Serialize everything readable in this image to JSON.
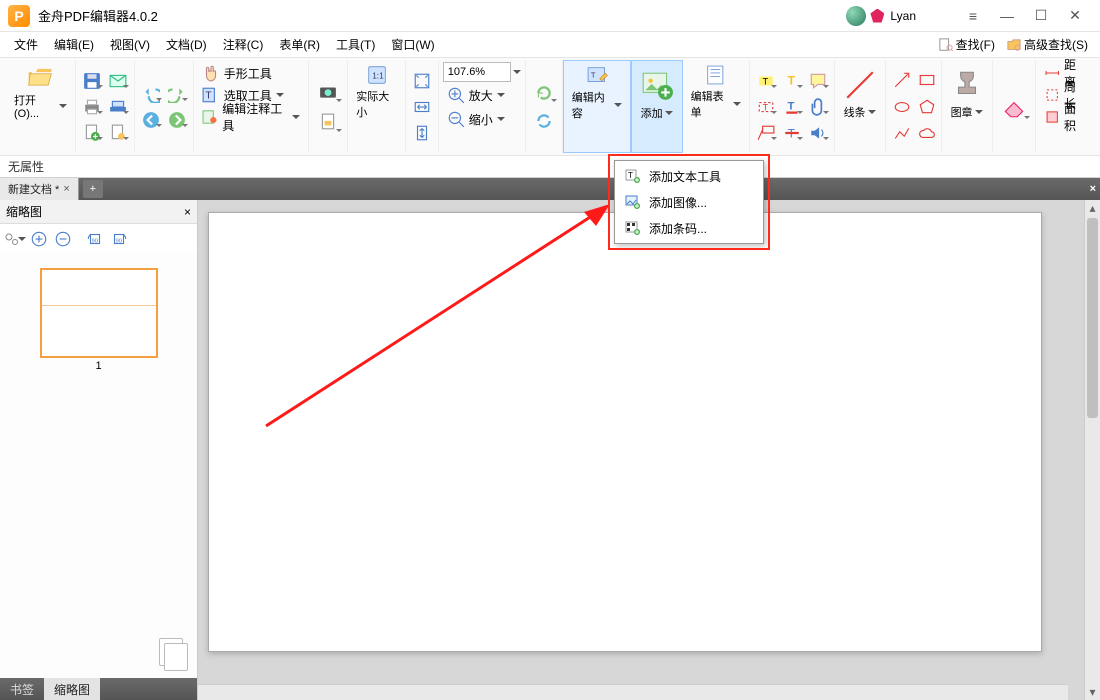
{
  "app": {
    "title": "金舟PDF编辑器4.0.2",
    "user": "Lyan"
  },
  "menu": {
    "items": [
      "文件",
      "编辑(E)",
      "视图(V)",
      "文档(D)",
      "注释(C)",
      "表单(R)",
      "工具(T)",
      "窗口(W)"
    ],
    "find": "查找(F)",
    "advfind": "高级查找(S)"
  },
  "toolbar": {
    "open": "打开(O)...",
    "hand": "手形工具",
    "select": "选取工具",
    "annotate": "编辑注释工具",
    "actual": "实际大小",
    "zoom_in": "放大",
    "zoom_out": "缩小",
    "zoom_value": "107.6%",
    "edit_content": "编辑内容",
    "add": "添加",
    "edit_form": "编辑表单",
    "lines": "线条",
    "stamp": "图章",
    "distance": "距离",
    "perimeter": "周长",
    "area": "面积"
  },
  "dropdown": {
    "add_text": "添加文本工具",
    "add_image": "添加图像...",
    "add_barcode": "添加条码..."
  },
  "properties": {
    "none": "无属性"
  },
  "tabs": {
    "doc": "新建文档 *"
  },
  "side": {
    "title": "缩略图",
    "tab_bookmarks": "书签",
    "tab_thumbs": "缩略图",
    "page_number": "1"
  }
}
